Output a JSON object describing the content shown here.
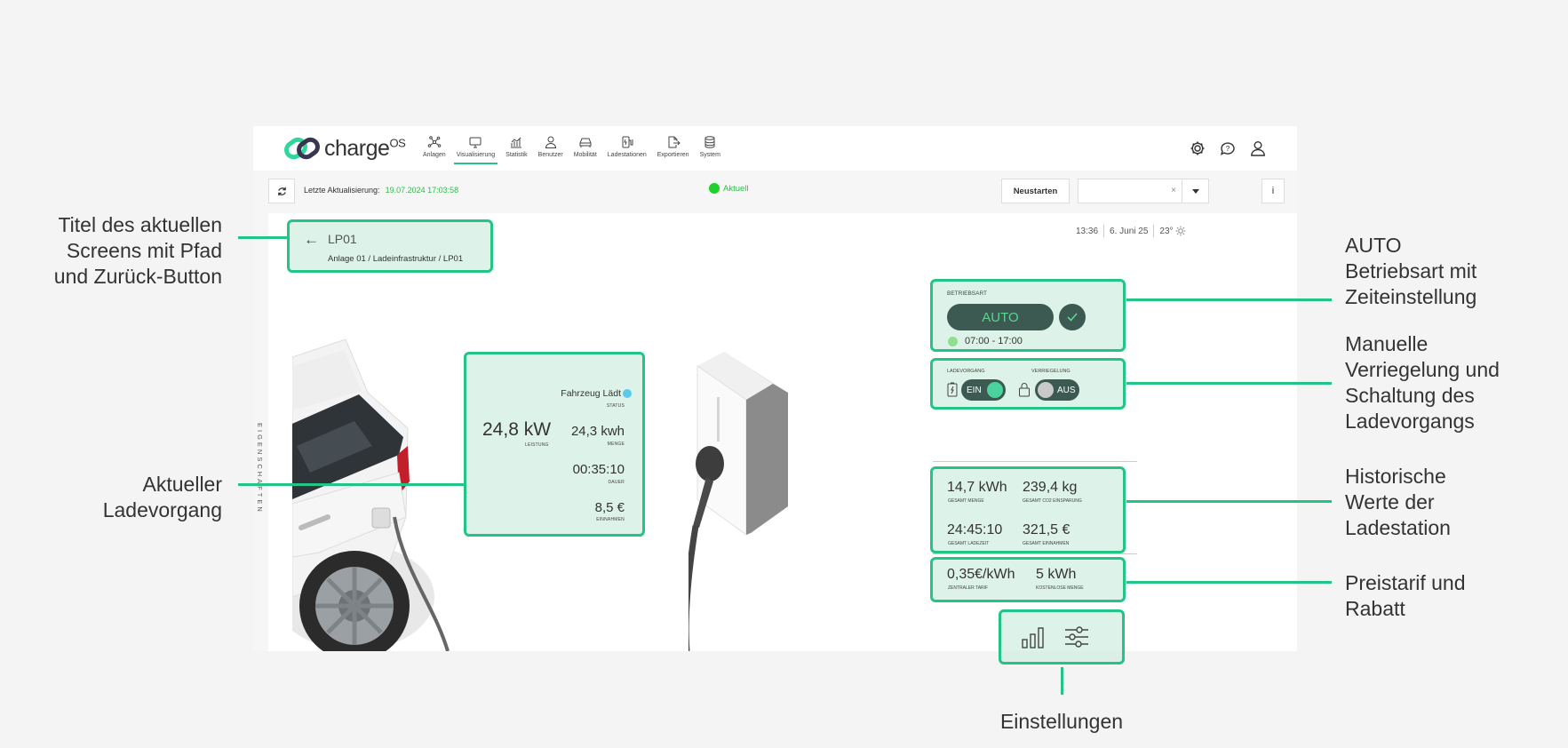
{
  "app": {
    "logo_text": "charge",
    "logo_sup": "OS",
    "nav": [
      {
        "label": "Anlagen",
        "icon": "network-icon"
      },
      {
        "label": "Visualisierung",
        "icon": "monitor-icon"
      },
      {
        "label": "Statistik",
        "icon": "chart-icon"
      },
      {
        "label": "Benutzer",
        "icon": "user-icon"
      },
      {
        "label": "Mobilität",
        "icon": "car-icon"
      },
      {
        "label": "Ladestationen",
        "icon": "charger-icon"
      },
      {
        "label": "Exportieren",
        "icon": "export-icon"
      },
      {
        "label": "System",
        "icon": "database-icon"
      }
    ],
    "active_nav": "Visualisierung",
    "toolbar": {
      "last_update_label": "Letzte Aktualisierung:",
      "last_update_value": "19.07.2024 17:03:58",
      "status": "Aktuell",
      "restart_label": "Neustarten",
      "select_clear": "×",
      "info_label": "i"
    },
    "side_label": "EIGENSCHAFTEN",
    "timebar": {
      "time": "13:36",
      "date": "6. Juni 25",
      "temp": "23°"
    }
  },
  "title_box": {
    "back": "←",
    "name": "LP01",
    "path": "Anlage 01 / Ladeinfrastruktur / LP01"
  },
  "charge": {
    "status": "Fahrzeug Lädt",
    "status_caption": "STATUS",
    "power": "24,8 kW",
    "power_caption": "LEISTUNG",
    "amount": "24,3 kwh",
    "amount_caption": "MENGE",
    "duration": "00:35:10",
    "duration_caption": "DAUER",
    "revenue": "8,5 €",
    "revenue_caption": "EINNAHMEN"
  },
  "mode": {
    "caption": "BETRIEBSART",
    "value": "AUTO",
    "time": "07:00 - 17:00"
  },
  "toggles": {
    "charge_caption": "LADEVORGANG",
    "charge_state": "EIN",
    "lock_caption": "VERRIEGELUNG",
    "lock_state": "AUS"
  },
  "history": {
    "total_amount": "14,7 kWh",
    "total_amount_caption": "GESAMT MENGE",
    "co2": "239,4 kg",
    "co2_caption": "GESAMT CO2 EINSPARUNG",
    "total_time": "24:45:10",
    "total_time_caption": "GESAMT LADEZEIT",
    "total_revenue": "321,5 €",
    "total_revenue_caption": "GESAMT EINNAHMEN"
  },
  "tariff": {
    "price": "0,35€/kWh",
    "price_caption": "ZENTRALER TARIF",
    "free": "5 kWh",
    "free_caption": "KOSTENLOSE MENGE"
  },
  "callouts": {
    "title": "Titel des aktuellen Screens mit Pfad und Zurück-Button",
    "title_lines": [
      "Titel des aktuellen",
      "Screens mit Pfad",
      "und Zurück-Button"
    ],
    "charge_lines": [
      "Aktueller",
      "Ladevorgang"
    ],
    "mode_lines": [
      "AUTO",
      "Betriebsart mit",
      "Zeiteinstellung"
    ],
    "manual_lines": [
      "Manuelle",
      "Verriegelung und",
      "Schaltung des",
      "Ladevorgangs"
    ],
    "history_lines": [
      "Historische",
      "Werte der",
      "Ladestation"
    ],
    "tariff_lines": [
      "Preistarif und",
      "Rabatt"
    ],
    "settings": "Einstellungen"
  },
  "colors": {
    "accent": "#22c585",
    "dark_pill": "#3c5a52",
    "status_green": "#2fbd4c"
  }
}
